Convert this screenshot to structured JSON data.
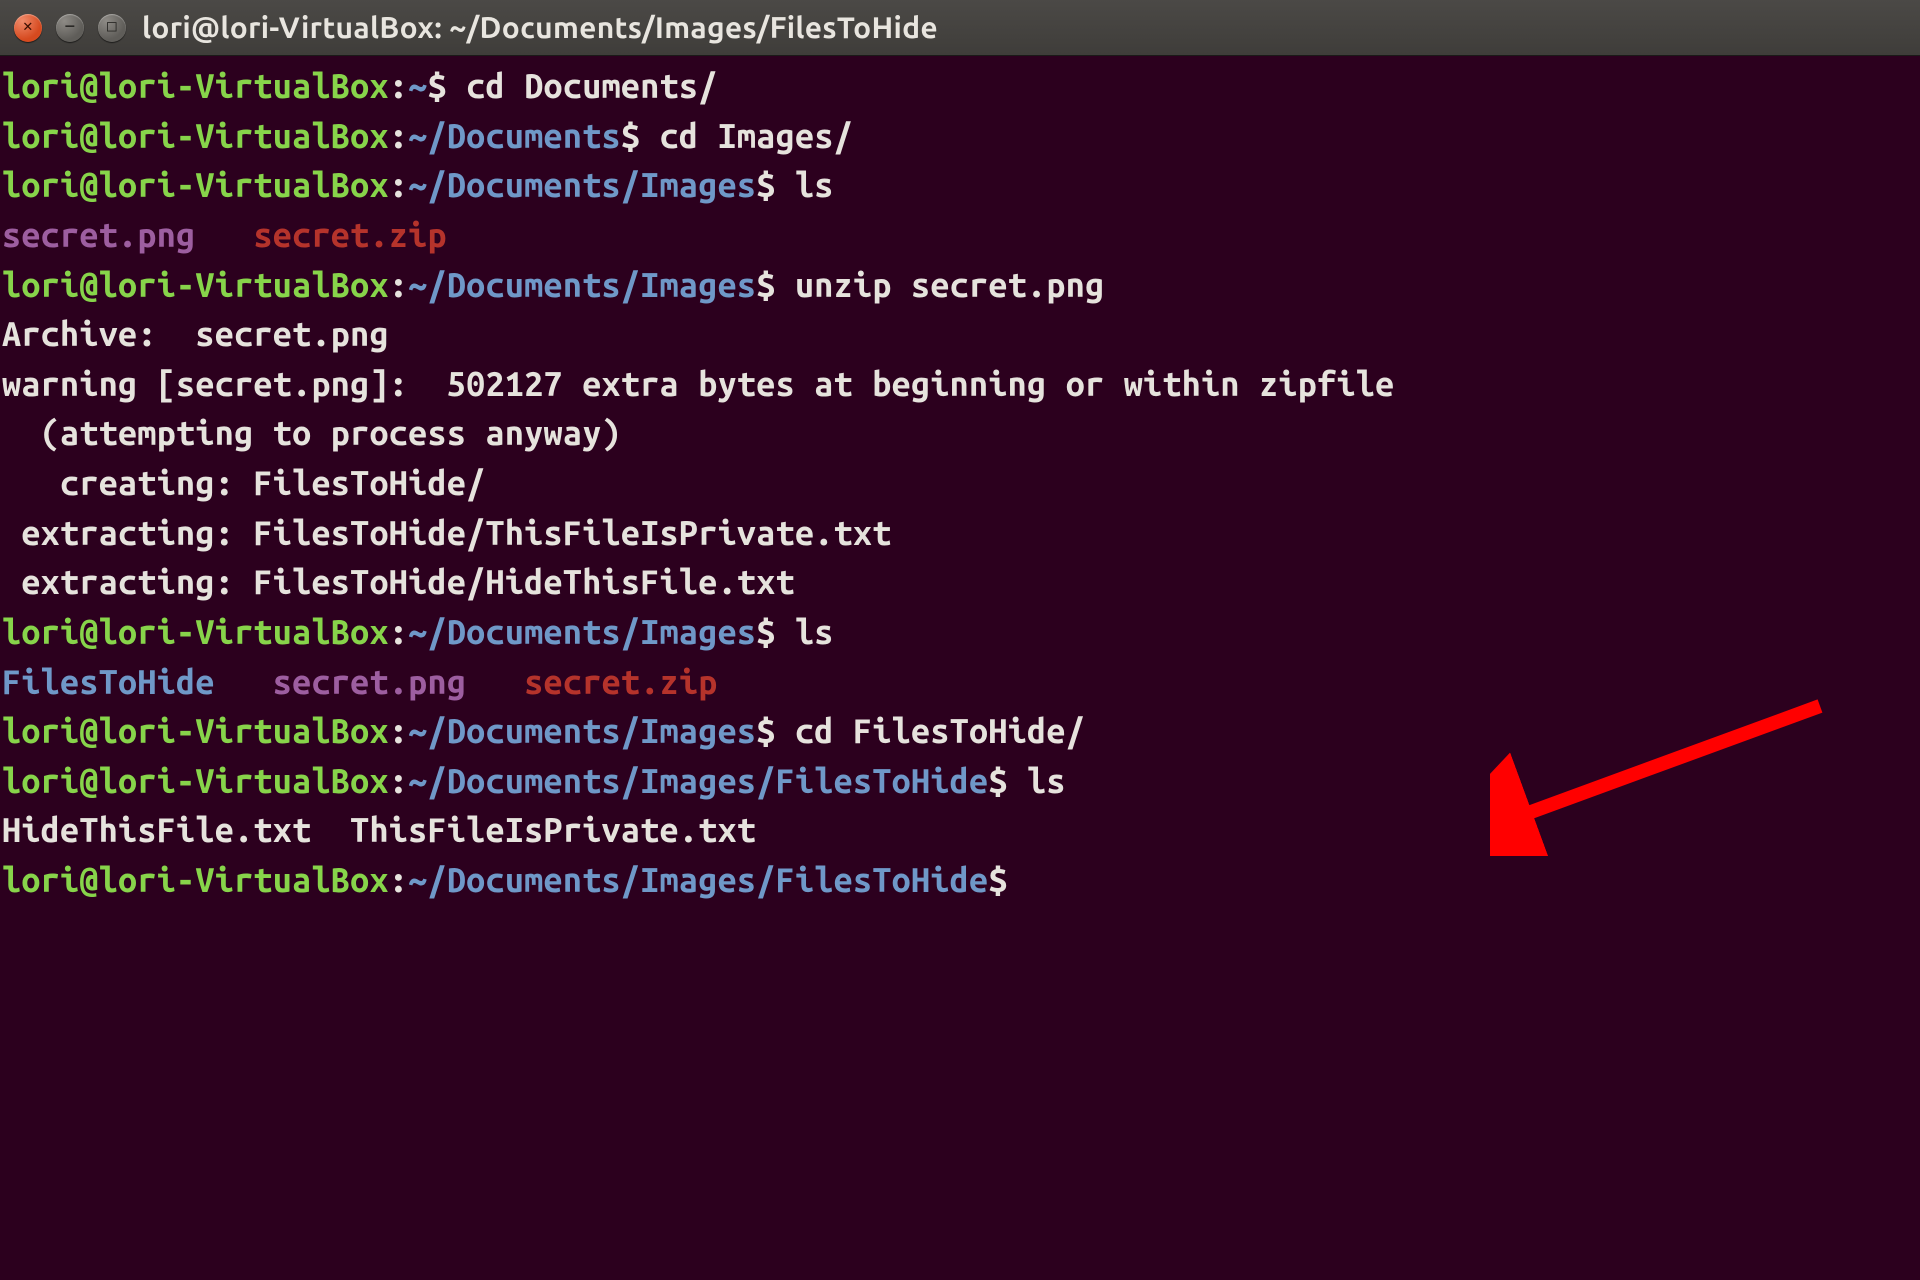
{
  "window": {
    "title": "lori@lori-VirtualBox: ~/Documents/Images/FilesToHide"
  },
  "colors": {
    "background": "#2c001e",
    "prompt_user_host": "#87d44a",
    "prompt_path": "#6f98c8",
    "text": "#e6e3dd",
    "file_image": "#9d5ea0",
    "file_archive": "#b5332b",
    "directory": "#6f98c8",
    "arrow": "#ff0000"
  },
  "prompt": {
    "user_host": "lori@lori-VirtualBox",
    "sep_colon": ":",
    "tilde": "~",
    "dollar": "$"
  },
  "paths": {
    "home": "~",
    "docs": "~/Documents",
    "images": "~/Documents/Images",
    "filestohide": "~/Documents/Images/FilesToHide"
  },
  "cmds": {
    "cd_documents": "cd Documents/",
    "cd_images": "cd Images/",
    "ls1": "ls",
    "unzip": "unzip secret.png",
    "ls2": "ls",
    "cd_filestohide": "cd FilesToHide/",
    "ls3": "ls"
  },
  "ls_out1": {
    "img": "secret.png",
    "zip": "secret.zip"
  },
  "unzip_out": {
    "l1": "Archive:  secret.png",
    "l2": "warning [secret.png]:  502127 extra bytes at beginning or within zipfile",
    "l3": "  (attempting to process anyway)",
    "l4": "   creating: FilesToHide/",
    "l5": " extracting: FilesToHide/ThisFileIsPrivate.txt",
    "l6": " extracting: FilesToHide/HideThisFile.txt"
  },
  "ls_out2": {
    "dir": "FilesToHide",
    "img": "secret.png",
    "zip": "secret.zip"
  },
  "ls_out3": {
    "line": "HideThisFile.txt  ThisFileIsPrivate.txt"
  },
  "annotation": {
    "type": "arrow",
    "color": "#ff0000",
    "points_to": "cd FilesToHide/ command line"
  }
}
